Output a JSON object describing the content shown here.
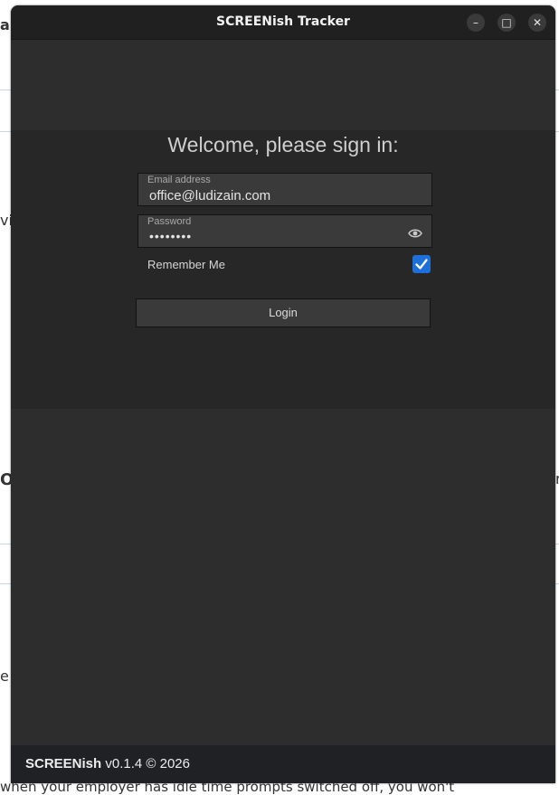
{
  "window": {
    "title": "SCREENish Tracker",
    "controls": {
      "minimize": "–",
      "maximize": "□",
      "close": "✕"
    }
  },
  "login": {
    "heading": "Welcome, please sign in:",
    "email": {
      "label": "Email address",
      "value": "office@ludizain.com"
    },
    "password": {
      "label": "Password",
      "value": "••••••••",
      "toggle_icon": "eye-icon"
    },
    "remember": {
      "label": "Remember Me",
      "checked": true
    },
    "login_button": "Login"
  },
  "footer": {
    "brand": "SCREENish",
    "version": " v0.1.4 © 2026"
  },
  "background_page": {
    "fragments": [
      "a",
      "vit",
      "O",
      "r",
      "e n",
      "when your employer has idle time prompts switched off, you won't"
    ]
  },
  "colors": {
    "window_bg": "#2d2d2d",
    "panel_bg": "#272727",
    "titlebar_bg": "#202020",
    "checkbox_accent": "#1f6fd8",
    "footer_bg": "#202124"
  }
}
